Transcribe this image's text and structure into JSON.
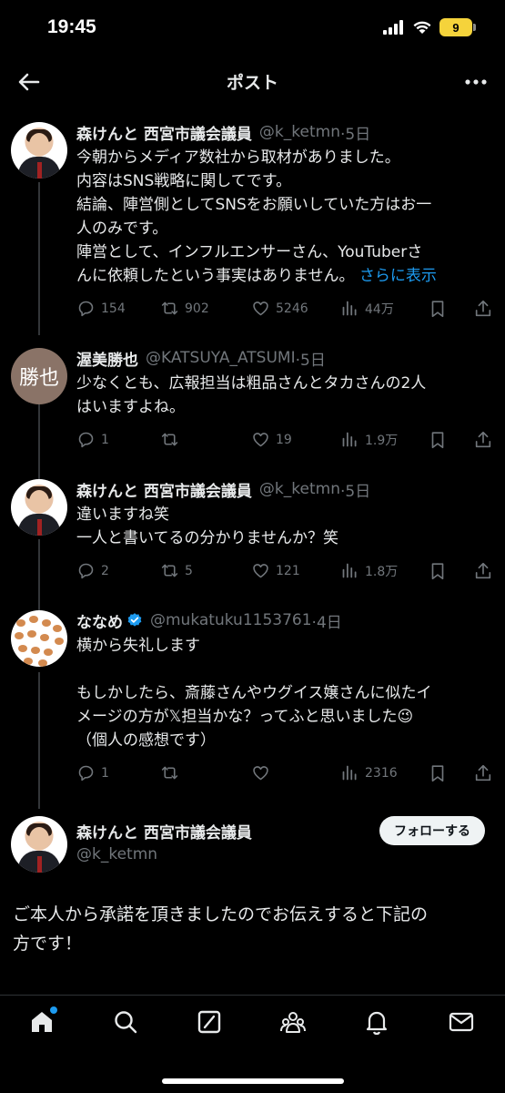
{
  "status_bar": {
    "time": "19:45",
    "battery": "9"
  },
  "header": {
    "title": "ポスト"
  },
  "posts": [
    {
      "name": "森けんと 西宮市議会議員",
      "handle": "@k_ketmn",
      "time": "·5日",
      "lines": [
        "今朝からメディア数社から取材がありました。",
        "内容はSNS戦略に関してです。",
        "結論、陣営側としてSNSをお願いしていた方はお一",
        "人のみです。",
        "陣営として、インフルエンサーさん、YouTuberさ",
        "んに依頼したという事実はありません。"
      ],
      "show_more": "さらに表示",
      "replies": "154",
      "reposts": "902",
      "likes": "5246",
      "views": "44万"
    },
    {
      "name": "渥美勝也",
      "handle": "@KATSUYA_ATSUMI",
      "time": "·5日",
      "avatar_text": "勝也",
      "lines": [
        "少なくとも、広報担当は粗品さんとタカさんの2人",
        "はいますよね。"
      ],
      "replies": "1",
      "reposts": "",
      "likes": "19",
      "views": "1.9万"
    },
    {
      "name": "森けんと 西宮市議会議員",
      "handle": "@k_ketmn",
      "time": "·5日",
      "lines": [
        "違いますね笑",
        "一人と書いてるの分かりませんか？笑"
      ],
      "replies": "2",
      "reposts": "5",
      "likes": "121",
      "views": "1.8万"
    },
    {
      "name": "ななめ",
      "handle": "@mukatuku1153761",
      "time": "·4日",
      "lines": [
        "横から失礼します",
        "",
        "もしかしたら、斎藤さんやウグイス嬢さんに似たイ",
        "メージの方が𝕏担当かな？ってふと思いました😉",
        "（個人の感想です）"
      ],
      "replies": "1",
      "reposts": "",
      "likes": "",
      "views": "2316"
    }
  ],
  "main_post": {
    "name": "森けんと 西宮市議会議員",
    "handle": "@k_ketmn",
    "follow_label": "フォローする",
    "lines": [
      "ご本人から承諾を頂きましたのでお伝えすると下記の",
      "方です！"
    ]
  },
  "colors": {
    "accent": "#1d9bf0",
    "muted": "#71767b",
    "verified": "#1d9bf0"
  },
  "icons": {
    "nav": [
      "home-icon",
      "search-icon",
      "grok-icon",
      "communities-icon",
      "notifications-icon",
      "messages-icon"
    ]
  }
}
